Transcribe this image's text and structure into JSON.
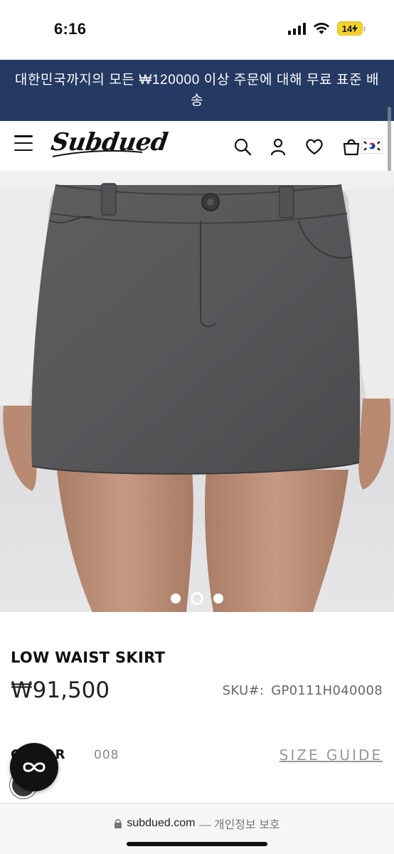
{
  "status_bar": {
    "time": "6:16",
    "battery": "14",
    "battery_color": "#f4d12e"
  },
  "promo": {
    "text": "대한민국까지의 모든 ₩120000 이상 주문에 대해 무료 표준 배송",
    "background": "#243a63"
  },
  "header": {
    "logo_text": "Subdued",
    "icons": [
      "menu-icon",
      "search-icon",
      "account-icon",
      "wishlist-heart-icon",
      "cart-bag-icon",
      "korea-flag-icon"
    ]
  },
  "gallery": {
    "slide_count": 3,
    "active_slide": 2
  },
  "product": {
    "title": "LOW WAIST SKIRT",
    "price": "₩91,500",
    "sku_label": "SKU#:",
    "sku_value": "GP0111H040008",
    "color_label": "COLOR",
    "color_value": "008",
    "size_guide": "SIZE GUIDE",
    "swatch_color": "#3a3a3c"
  },
  "browser": {
    "url": "subdued.com",
    "privacy": "— 개인정보 보호"
  }
}
